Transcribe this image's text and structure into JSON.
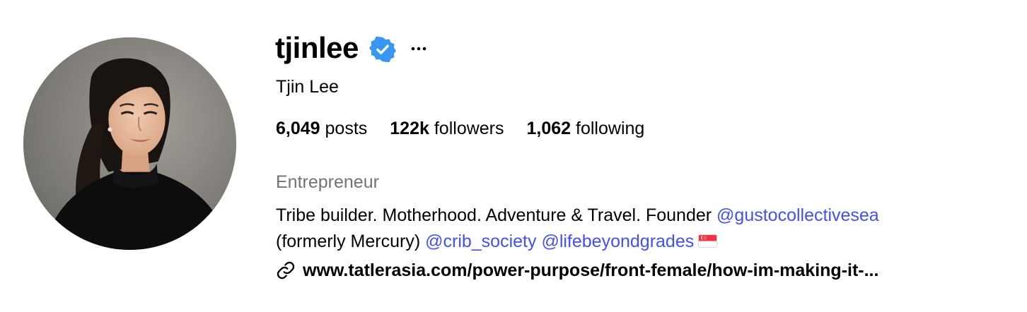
{
  "profile": {
    "username": "tjinlee",
    "full_name": "Tjin Lee",
    "verified": true,
    "stats": {
      "posts_count": "6,049",
      "posts_label": "posts",
      "followers_count": "122k",
      "followers_label": "followers",
      "following_count": "1,062",
      "following_label": "following"
    },
    "category": "Entrepreneur",
    "bio": {
      "line1_text": "Tribe builder. Motherhood. Adventure & Travel. Founder ",
      "line1_mention": "@gustocollectivesea",
      "line2_text": "(formerly Mercury) ",
      "line2_mention1": "@crib_society",
      "line2_mention2": "@lifebeyondgrades",
      "line2_emoji": "🇸🇬"
    },
    "link": "www.tatlerasia.com/power-purpose/front-female/how-im-making-it-..."
  },
  "colors": {
    "text": "#000000",
    "secondary_text": "#737373",
    "mention": "#4150f7",
    "verified_badge": "#3897f0"
  },
  "icons": {
    "verified": "verified-badge-icon",
    "more": "more-options-icon",
    "link": "link-icon",
    "flag": "singapore-flag-icon"
  }
}
